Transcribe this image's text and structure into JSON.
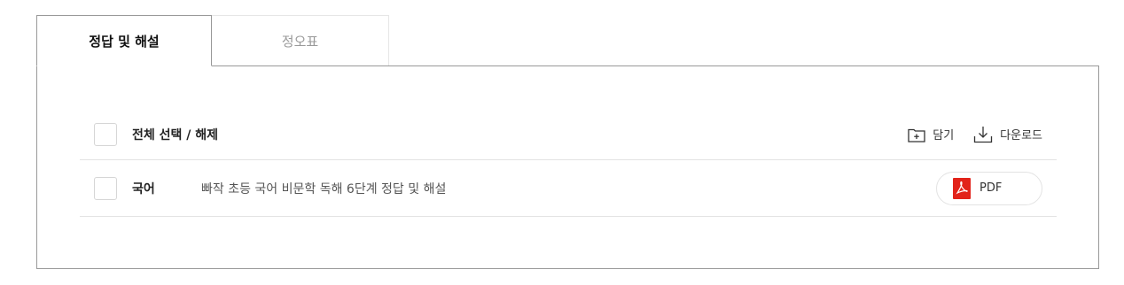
{
  "tabs": [
    {
      "label": "정답 및 해설",
      "active": true
    },
    {
      "label": "정오표",
      "active": false
    }
  ],
  "list_header": {
    "select_all_label": "전체 선택 / 해제",
    "actions": {
      "save_label": "담기",
      "save_icon": "folder-plus-icon",
      "download_label": "다운로드",
      "download_icon": "download-icon"
    }
  },
  "items": [
    {
      "subject": "국어",
      "title": "빠작 초등 국어 비문학 독해 6단계 정답 및 해설",
      "file_type_label": "PDF",
      "file_icon": "pdf-icon",
      "checked": false
    }
  ],
  "colors": {
    "pdf_red": "#e2231a",
    "border": "#999999",
    "divider": "#e3e3e3"
  }
}
